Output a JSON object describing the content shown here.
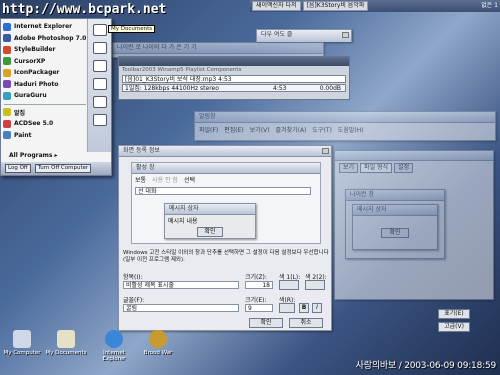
{
  "watermark": "http://www.bcpark.net",
  "taskbar": {
    "buttons": [
      "새이맥신자 다저",
      "[음]K3Story비 음악파"
    ],
    "right": "없은 1"
  },
  "start_menu": {
    "items": [
      {
        "label": "Internet Explorer",
        "color": "#2a6fd6"
      },
      {
        "label": "Adobe Photoshop 7.0",
        "color": "#3b5aa6"
      },
      {
        "label": "StyleBuilder",
        "color": "#d04a2a"
      },
      {
        "label": "CursorXP",
        "color": "#3b9a3b"
      },
      {
        "label": "IconPackager",
        "color": "#e0a020"
      },
      {
        "label": "Haduri Photo",
        "color": "#7a4ab0"
      },
      {
        "label": "GuraGuru",
        "color": "#3aa0c0"
      },
      {
        "label": "알집",
        "color": "#c8c020"
      },
      {
        "label": "ACDSee 5.0",
        "color": "#d04040"
      },
      {
        "label": "Paint",
        "color": "#4a80c0"
      }
    ],
    "all_programs": "All Programs",
    "log_off": "Log Off",
    "turn_off": "Turn Off Computer",
    "tooltip": "My Documents"
  },
  "top_dialog": {
    "title": "다우 여도 즐"
  },
  "bg_window": {
    "title": "나이런 로 나이의 다 가 은 기 기"
  },
  "winamp": {
    "menu": "Toolbar2003   Winamp5   Playlist   Components",
    "track": "[음]01_K3Story비 보석 대장.mp3  4:53",
    "info": "1일집: 128kbps 44100Hz stereo",
    "time": "4:53",
    "percent": "0.00dB"
  },
  "right_window": {
    "title": "알림창",
    "menu": [
      "파일(F)",
      "편집(E)",
      "보기(V)",
      "즐겨찾기(A)",
      "도구(T)",
      "도움말(H)"
    ]
  },
  "tabs_window": {
    "tabs": [
      "보기",
      "파일 형식",
      "설정"
    ],
    "inner_title": "나이런 창",
    "msg_title": "메시지 상자",
    "ok": "확인"
  },
  "main_dialog": {
    "title": "화면 등록 정보",
    "inner_title": "활성 창",
    "rows": [
      "보통",
      "선 대화"
    ],
    "disabled": "사용 안 함",
    "selected": "선택",
    "msg_title": "메시지 상자",
    "msg_body": "메시지 내용",
    "ok": "확인",
    "desc": "Windows 고전 스타일 이외의 창과 단추를 선택하면 그 설정이 다음 설정보다 우선합니다(일부 이전 프로그램 제외).",
    "item_label": "항목(I):",
    "item_value": "비활성 제목 표시줄",
    "size_label": "크기(Z):",
    "size_value": "18",
    "color1": "색 1(L):",
    "color2": "색 2(2):",
    "font_label": "글꼴(F):",
    "font_value": "굴림",
    "fsize_label": "크기(E):",
    "fsize_value": "9",
    "fcolor": "색(R):",
    "bold": "B",
    "italic": "I",
    "ok_btn": "확인",
    "cancel_btn": "취소"
  },
  "right_buttons": [
    "표기(E)",
    "고급(V)"
  ],
  "desktop_icons": [
    {
      "label": "My Computer",
      "color": "#cfd8e6"
    },
    {
      "label": "My Documents",
      "color": "#e6e0c8"
    },
    {
      "label": "Internet Explorer",
      "color": "#3a86d8"
    },
    {
      "label": "Brood War",
      "color": "#c89a30"
    }
  ],
  "clock": "사랑의바보 / 2003-06-09 09:18:59"
}
